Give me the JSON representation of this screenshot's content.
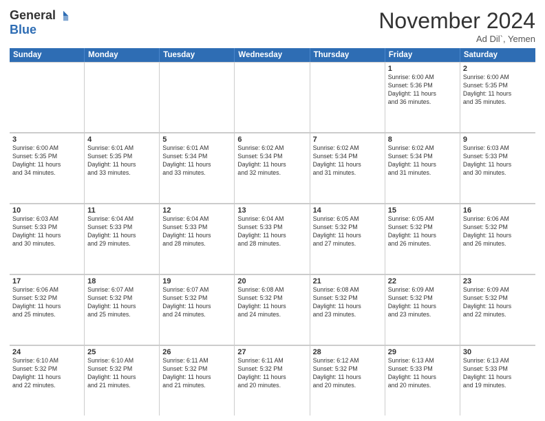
{
  "header": {
    "logo_general": "General",
    "logo_blue": "Blue",
    "month_title": "November 2024",
    "location": "Ad Dil`, Yemen"
  },
  "weekdays": [
    "Sunday",
    "Monday",
    "Tuesday",
    "Wednesday",
    "Thursday",
    "Friday",
    "Saturday"
  ],
  "rows": [
    [
      {
        "day": "",
        "info": ""
      },
      {
        "day": "",
        "info": ""
      },
      {
        "day": "",
        "info": ""
      },
      {
        "day": "",
        "info": ""
      },
      {
        "day": "",
        "info": ""
      },
      {
        "day": "1",
        "info": "Sunrise: 6:00 AM\nSunset: 5:36 PM\nDaylight: 11 hours\nand 36 minutes."
      },
      {
        "day": "2",
        "info": "Sunrise: 6:00 AM\nSunset: 5:35 PM\nDaylight: 11 hours\nand 35 minutes."
      }
    ],
    [
      {
        "day": "3",
        "info": "Sunrise: 6:00 AM\nSunset: 5:35 PM\nDaylight: 11 hours\nand 34 minutes."
      },
      {
        "day": "4",
        "info": "Sunrise: 6:01 AM\nSunset: 5:35 PM\nDaylight: 11 hours\nand 33 minutes."
      },
      {
        "day": "5",
        "info": "Sunrise: 6:01 AM\nSunset: 5:34 PM\nDaylight: 11 hours\nand 33 minutes."
      },
      {
        "day": "6",
        "info": "Sunrise: 6:02 AM\nSunset: 5:34 PM\nDaylight: 11 hours\nand 32 minutes."
      },
      {
        "day": "7",
        "info": "Sunrise: 6:02 AM\nSunset: 5:34 PM\nDaylight: 11 hours\nand 31 minutes."
      },
      {
        "day": "8",
        "info": "Sunrise: 6:02 AM\nSunset: 5:34 PM\nDaylight: 11 hours\nand 31 minutes."
      },
      {
        "day": "9",
        "info": "Sunrise: 6:03 AM\nSunset: 5:33 PM\nDaylight: 11 hours\nand 30 minutes."
      }
    ],
    [
      {
        "day": "10",
        "info": "Sunrise: 6:03 AM\nSunset: 5:33 PM\nDaylight: 11 hours\nand 30 minutes."
      },
      {
        "day": "11",
        "info": "Sunrise: 6:04 AM\nSunset: 5:33 PM\nDaylight: 11 hours\nand 29 minutes."
      },
      {
        "day": "12",
        "info": "Sunrise: 6:04 AM\nSunset: 5:33 PM\nDaylight: 11 hours\nand 28 minutes."
      },
      {
        "day": "13",
        "info": "Sunrise: 6:04 AM\nSunset: 5:33 PM\nDaylight: 11 hours\nand 28 minutes."
      },
      {
        "day": "14",
        "info": "Sunrise: 6:05 AM\nSunset: 5:32 PM\nDaylight: 11 hours\nand 27 minutes."
      },
      {
        "day": "15",
        "info": "Sunrise: 6:05 AM\nSunset: 5:32 PM\nDaylight: 11 hours\nand 26 minutes."
      },
      {
        "day": "16",
        "info": "Sunrise: 6:06 AM\nSunset: 5:32 PM\nDaylight: 11 hours\nand 26 minutes."
      }
    ],
    [
      {
        "day": "17",
        "info": "Sunrise: 6:06 AM\nSunset: 5:32 PM\nDaylight: 11 hours\nand 25 minutes."
      },
      {
        "day": "18",
        "info": "Sunrise: 6:07 AM\nSunset: 5:32 PM\nDaylight: 11 hours\nand 25 minutes."
      },
      {
        "day": "19",
        "info": "Sunrise: 6:07 AM\nSunset: 5:32 PM\nDaylight: 11 hours\nand 24 minutes."
      },
      {
        "day": "20",
        "info": "Sunrise: 6:08 AM\nSunset: 5:32 PM\nDaylight: 11 hours\nand 24 minutes."
      },
      {
        "day": "21",
        "info": "Sunrise: 6:08 AM\nSunset: 5:32 PM\nDaylight: 11 hours\nand 23 minutes."
      },
      {
        "day": "22",
        "info": "Sunrise: 6:09 AM\nSunset: 5:32 PM\nDaylight: 11 hours\nand 23 minutes."
      },
      {
        "day": "23",
        "info": "Sunrise: 6:09 AM\nSunset: 5:32 PM\nDaylight: 11 hours\nand 22 minutes."
      }
    ],
    [
      {
        "day": "24",
        "info": "Sunrise: 6:10 AM\nSunset: 5:32 PM\nDaylight: 11 hours\nand 22 minutes."
      },
      {
        "day": "25",
        "info": "Sunrise: 6:10 AM\nSunset: 5:32 PM\nDaylight: 11 hours\nand 21 minutes."
      },
      {
        "day": "26",
        "info": "Sunrise: 6:11 AM\nSunset: 5:32 PM\nDaylight: 11 hours\nand 21 minutes."
      },
      {
        "day": "27",
        "info": "Sunrise: 6:11 AM\nSunset: 5:32 PM\nDaylight: 11 hours\nand 20 minutes."
      },
      {
        "day": "28",
        "info": "Sunrise: 6:12 AM\nSunset: 5:32 PM\nDaylight: 11 hours\nand 20 minutes."
      },
      {
        "day": "29",
        "info": "Sunrise: 6:13 AM\nSunset: 5:33 PM\nDaylight: 11 hours\nand 20 minutes."
      },
      {
        "day": "30",
        "info": "Sunrise: 6:13 AM\nSunset: 5:33 PM\nDaylight: 11 hours\nand 19 minutes."
      }
    ]
  ]
}
